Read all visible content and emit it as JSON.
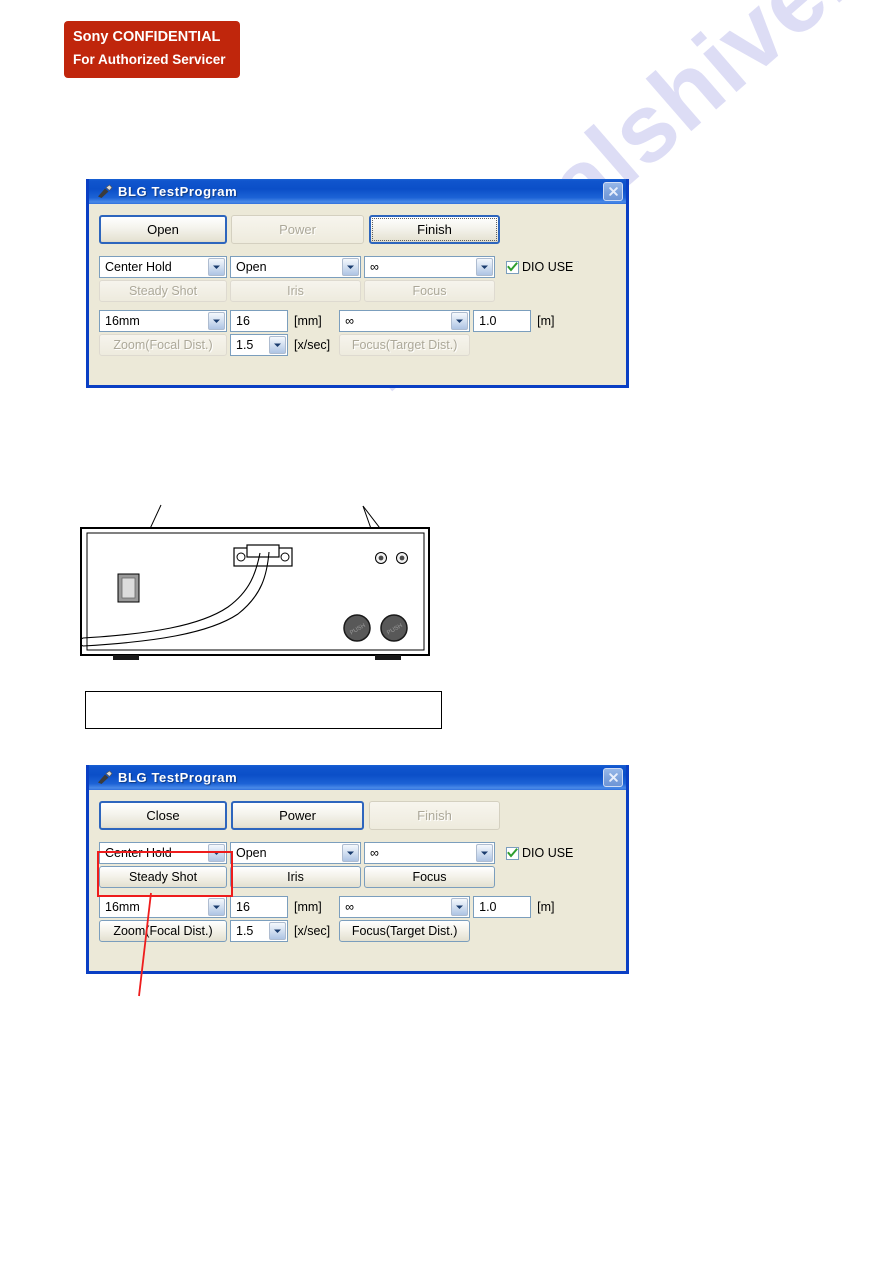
{
  "confidential": {
    "line1": "Sony CONFIDENTIAL",
    "line2": "For Authorized Servicer",
    "color": "#c0260c"
  },
  "watermark": {
    "text": "manualshive.com",
    "color": "#c9c9ef"
  },
  "dialog_top": {
    "title": "BLG TestProgram",
    "icon": "wrench-icon",
    "close_icon": "close-icon",
    "buttons": [
      {
        "label": "Open",
        "state": "default"
      },
      {
        "label": "Power",
        "state": "disabled"
      },
      {
        "label": "Finish",
        "state": "focused"
      }
    ],
    "row1": {
      "combo_steady": {
        "value": "Center Hold",
        "label": "Steady Shot",
        "label_state": "disabled"
      },
      "combo_iris": {
        "value": "Open",
        "label": "Iris",
        "label_state": "disabled"
      },
      "combo_focus": {
        "value": "∞",
        "label": "Focus",
        "label_state": "disabled"
      },
      "dio": {
        "label": "DIO USE",
        "checked": true
      }
    },
    "row2": {
      "combo_zoom": {
        "value": "16mm",
        "label": "Zoom(Focal Dist.)",
        "label_state": "disabled"
      },
      "text_mm": {
        "value": "16",
        "unit": "[mm]"
      },
      "combo_speed": {
        "value": "1.5",
        "unit": "[x/sec]"
      },
      "combo_target": {
        "value": "∞",
        "label": "Focus(Target Dist.)",
        "label_state": "disabled"
      },
      "text_m": {
        "value": "1.0",
        "unit": "[m]"
      }
    }
  },
  "dialog_bottom": {
    "title": "BLG TestProgram",
    "icon": "wrench-icon",
    "close_icon": "close-icon",
    "buttons": [
      {
        "label": "Close",
        "state": "default"
      },
      {
        "label": "Power",
        "state": "default"
      },
      {
        "label": "Finish",
        "state": "disabled"
      }
    ],
    "row1": {
      "combo_steady": {
        "value": "Center Hold",
        "label": "Steady Shot",
        "label_state": "enabled"
      },
      "combo_iris": {
        "value": "Open",
        "label": "Iris",
        "label_state": "enabled"
      },
      "combo_focus": {
        "value": "∞",
        "label": "Focus",
        "label_state": "enabled"
      },
      "dio": {
        "label": "DIO USE",
        "checked": true
      }
    },
    "row2": {
      "combo_zoom": {
        "value": "16mm",
        "label": "Zoom(Focal Dist.)",
        "label_state": "enabled"
      },
      "text_mm": {
        "value": "16",
        "unit": "[mm]"
      },
      "combo_speed": {
        "value": "1.5",
        "unit": "[x/sec]"
      },
      "combo_target": {
        "value": "∞",
        "label": "Focus(Target Dist.)",
        "label_state": "enabled"
      },
      "text_m": {
        "value": "1.0",
        "unit": "[m]"
      }
    },
    "annotation": {
      "highlight_color": "#ee1c1c"
    }
  },
  "diagram": {
    "name": "rear-panel-illustration",
    "knob_left_label": "PUSH",
    "knob_right_label": "PUSH"
  },
  "caption_box": {
    "text": ""
  }
}
